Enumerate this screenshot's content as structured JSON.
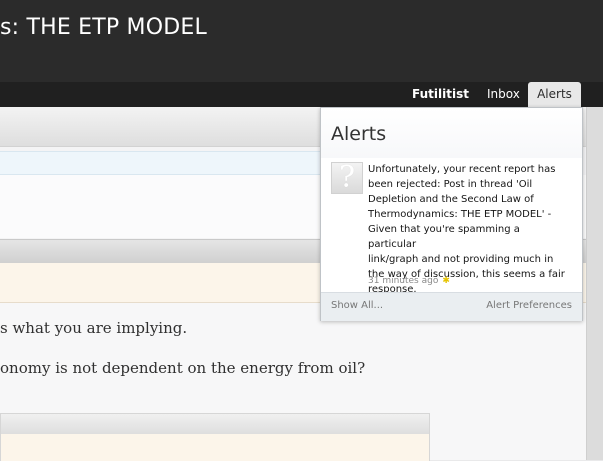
{
  "header": {
    "page_title": "s: THE ETP MODEL"
  },
  "nav": {
    "username": "Futilitist",
    "inbox": "Inbox",
    "alerts": "Alerts"
  },
  "post": {
    "line_1": "s what you are implying.",
    "line_2": "onomy is not dependent on the energy from oil?"
  },
  "alerts_popup": {
    "title": "Alerts",
    "items": [
      {
        "avatar_icon": "default-avatar-question-mark",
        "text": "Unfortunately, your recent report has\nbeen rejected: Post in thread 'Oil\nDepletion and the Second Law of\nThermodynamics: THE ETP MODEL' -\nGiven that you're spamming a particular\nlink/graph and not providing much in\nthe way of discussion, this seems a fair\nresponse.",
        "time": "31 minutes ago",
        "new_icon": "new-star-icon"
      }
    ],
    "footer": {
      "show_all": "Show All...",
      "preferences": "Alert Preferences"
    }
  },
  "colors": {
    "header_bg": "#2b2b2b",
    "nav_bg": "#202020",
    "active_tab_bg": "#e8e8e8",
    "popup_footer_bg": "#eaeef1",
    "new_icon": "#e6c400"
  }
}
